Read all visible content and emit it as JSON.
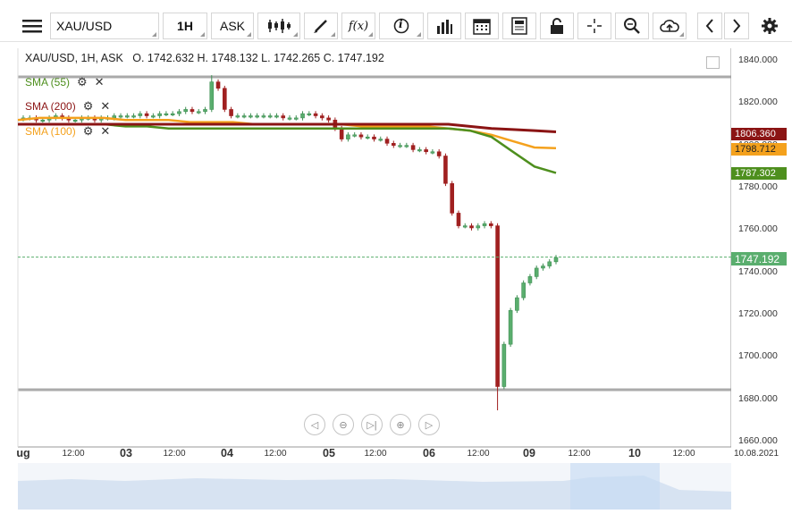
{
  "toolbar": {
    "symbol": "XAU/USD",
    "timeframe": "1H",
    "price_type": "ASK",
    "function_label": "f(x)",
    "info_label": "i"
  },
  "header": {
    "symbol": "XAU/USD",
    "timeframe": "1H",
    "price_type": "ASK",
    "open_label": "O.",
    "open": "1742.632",
    "high_label": "H.",
    "high": "1748.132",
    "low_label": "L.",
    "low": "1742.265",
    "close_label": "C.",
    "close": "1747.192"
  },
  "indicators": [
    {
      "label": "SMA (55)",
      "color": "#4e8f1e"
    },
    {
      "label": "SMA (200)",
      "color": "#8b1414"
    },
    {
      "label": "SMA (100)",
      "color": "#f4a11d"
    }
  ],
  "price_tags": [
    {
      "value": "1806.360",
      "color": "#8b1414"
    },
    {
      "value": "1798.712",
      "color": "#f4a11d"
    },
    {
      "value": "1787.302",
      "color": "#4e8f1e"
    },
    {
      "value": "1747.192",
      "color": "#5aae6e"
    }
  ],
  "chart_data": {
    "type": "candlestick",
    "y_ticks": [
      "1840.000",
      "1820.000",
      "1800.000",
      "1780.000",
      "1760.000",
      "1740.000",
      "1720.000",
      "1700.000",
      "1680.000",
      "1660.000"
    ],
    "ylim": [
      1660,
      1845
    ],
    "x_labels": [
      {
        "t": "ug",
        "day": true
      },
      {
        "t": "12:00"
      },
      {
        "t": "03",
        "day": true
      },
      {
        "t": "12:00"
      },
      {
        "t": "04",
        "day": true
      },
      {
        "t": "12:00"
      },
      {
        "t": "05",
        "day": true
      },
      {
        "t": "12:00"
      },
      {
        "t": "06",
        "day": true
      },
      {
        "t": "12:00"
      },
      {
        "t": "09",
        "day": true
      },
      {
        "t": "12:00"
      },
      {
        "t": "10",
        "day": true
      },
      {
        "t": "12:00"
      },
      {
        "t": "10.08.2021"
      }
    ],
    "close_path": [
      1813,
      1813,
      1812,
      1812,
      1813,
      1814,
      1813,
      1812,
      1812,
      1813,
      1813,
      1812,
      1813,
      1813,
      1814,
      1814,
      1814,
      1814,
      1815,
      1814,
      1814,
      1815,
      1815,
      1815,
      1816,
      1817,
      1816,
      1816,
      1817,
      1830,
      1827,
      1817,
      1814,
      1814,
      1814,
      1814,
      1814,
      1814,
      1814,
      1814,
      1813,
      1813,
      1813,
      1815,
      1815,
      1814,
      1813,
      1812,
      1808,
      1803,
      1805,
      1805,
      1804,
      1804,
      1803,
      1803,
      1801,
      1800,
      1800,
      1800,
      1798,
      1798,
      1797,
      1797,
      1795,
      1782,
      1768,
      1762,
      1762,
      1761,
      1762,
      1763,
      1762,
      1686,
      1706,
      1722,
      1728,
      1735,
      1738,
      1742,
      1743,
      1745,
      1747
    ],
    "sma55": [
      1810,
      1810,
      1810,
      1810,
      1810,
      1809,
      1809,
      1808,
      1808,
      1808,
      1808,
      1808,
      1808,
      1808,
      1808,
      1808,
      1808,
      1808,
      1808,
      1808,
      1808,
      1807,
      1804,
      1797,
      1790,
      1787
    ],
    "sma100": [
      1812,
      1813,
      1813,
      1813,
      1813,
      1812,
      1812,
      1812,
      1811,
      1811,
      1811,
      1810,
      1810,
      1810,
      1810,
      1810,
      1809,
      1809,
      1809,
      1809,
      1808,
      1807,
      1805,
      1802,
      1799,
      1798.7
    ],
    "sma200": [
      1810,
      1810,
      1810,
      1810,
      1810,
      1810,
      1810,
      1810,
      1810,
      1810,
      1810,
      1810,
      1810,
      1810,
      1810,
      1810,
      1810,
      1810,
      1810,
      1810,
      1810,
      1809,
      1808,
      1807.5,
      1807,
      1806.4
    ],
    "current_price": 1747.192,
    "grid": false
  }
}
